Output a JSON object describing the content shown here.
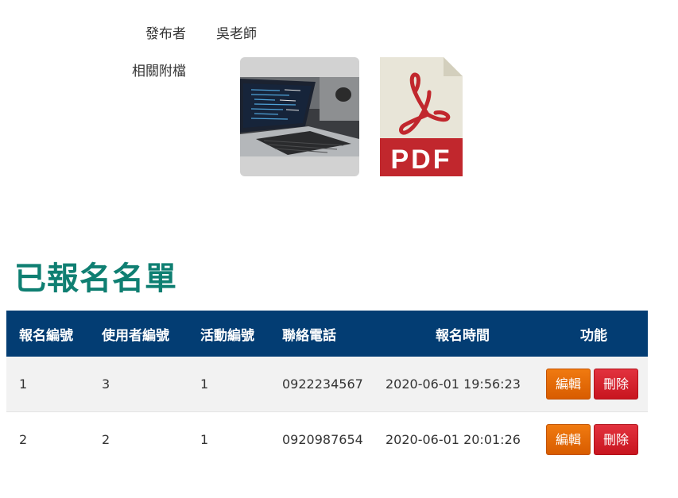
{
  "meta": {
    "publisher_label": "發布者",
    "publisher_value": "吳老師",
    "attachments_label": "相關附檔",
    "attachments": [
      {
        "type": "image",
        "icon": "laptop-photo-thumbnail"
      },
      {
        "type": "pdf",
        "icon": "pdf-file-icon",
        "text": "PDF"
      }
    ]
  },
  "section_title": "已報名名單",
  "table": {
    "headers": [
      "報名編號",
      "使用者編號",
      "活動編號",
      "聯絡電話",
      "報名時間",
      "功能"
    ],
    "rows": [
      {
        "id": "1",
        "user_id": "3",
        "activity_id": "1",
        "phone": "0922234567",
        "time": "2020-06-01 19:56:23"
      },
      {
        "id": "2",
        "user_id": "2",
        "activity_id": "1",
        "phone": "0920987654",
        "time": "2020-06-01 20:01:26"
      }
    ],
    "edit_label": "編輯",
    "delete_label": "刪除"
  },
  "colors": {
    "title": "#0f7f72",
    "header_bg": "#033d73",
    "edit_button": "#e86b06",
    "delete_button": "#d41f2b"
  }
}
